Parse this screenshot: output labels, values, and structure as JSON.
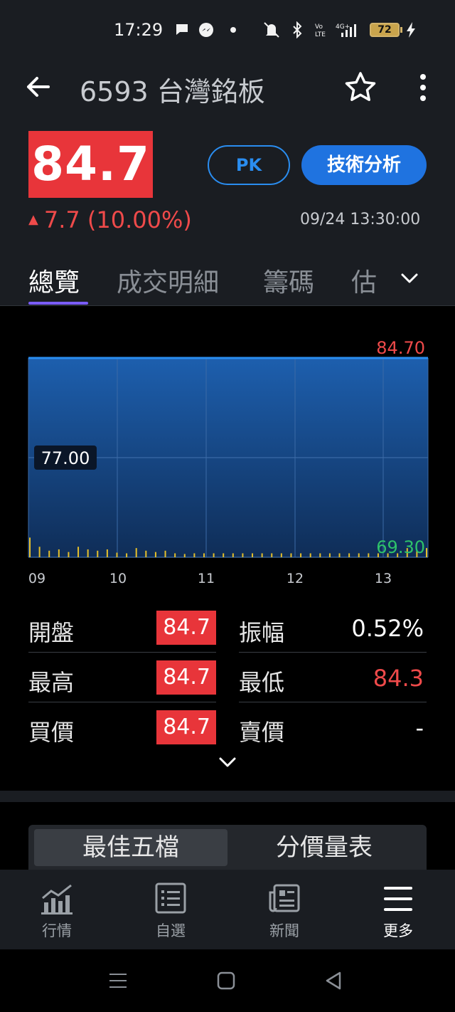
{
  "status_bar": {
    "time": "17:29",
    "battery": "72"
  },
  "header": {
    "title": "6593 台灣銘板",
    "price": "84.7",
    "pk_label": "PK",
    "ta_label": "技術分析",
    "change": "7.7 (10.00%)",
    "timestamp": "09/24 13:30:00"
  },
  "tabs": [
    "總覽",
    "成交明細",
    "籌碼",
    "估"
  ],
  "colors": {
    "up_red": "#e8353a",
    "down_green": "#2ec26a",
    "accent_blue": "#1f73e0",
    "tab_indicator": "#7a5cff",
    "volume_yellow": "#e6c02a"
  },
  "chart_data": {
    "type": "line",
    "x_ticks": [
      "09",
      "10",
      "11",
      "12",
      "13"
    ],
    "y_high": "84.70",
    "y_ref": "77.00",
    "y_low": "69.30",
    "ylim": [
      69.3,
      84.7
    ],
    "series": [
      {
        "values": [
          84.7,
          84.7,
          84.7,
          84.7,
          84.7,
          84.7
        ]
      }
    ],
    "volume": [
      30,
      16,
      10,
      12,
      8,
      16,
      12,
      10,
      12,
      7,
      6,
      14,
      10,
      8,
      10,
      6,
      5,
      6,
      6,
      6,
      6,
      6,
      6,
      6,
      6,
      6,
      6,
      6,
      6,
      6,
      6,
      6,
      6,
      6,
      6,
      6,
      6,
      6,
      6,
      14,
      10,
      14
    ]
  },
  "stats": {
    "open_label": "開盤",
    "open_value": "84.7",
    "amp_label": "振幅",
    "amp_value": "0.52%",
    "high_label": "最高",
    "high_value": "84.7",
    "low_label": "最低",
    "low_value": "84.3",
    "bid_label": "買價",
    "bid_value": "84.7",
    "ask_label": "賣價",
    "ask_value": "-"
  },
  "segments": {
    "best5": "最佳五檔",
    "price_volume": "分價量表"
  },
  "bottom_nav": [
    {
      "label": "行情",
      "icon": "chart-icon"
    },
    {
      "label": "自選",
      "icon": "list-icon"
    },
    {
      "label": "新聞",
      "icon": "news-icon"
    },
    {
      "label": "更多",
      "icon": "menu-icon"
    }
  ]
}
